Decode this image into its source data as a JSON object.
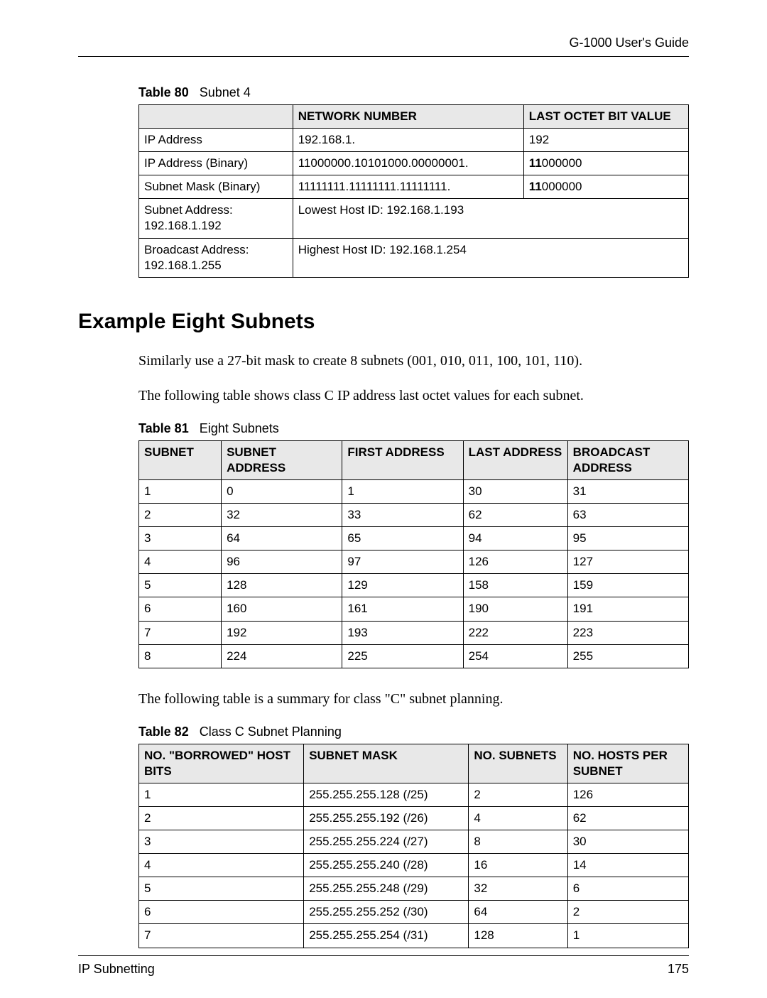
{
  "header": {
    "doc_title": "G-1000 User's Guide"
  },
  "table80": {
    "caption_label": "Table 80",
    "caption_text": "Subnet 4",
    "headers": {
      "col2": "NETWORK NUMBER",
      "col3": "LAST OCTET BIT VALUE"
    },
    "rows": {
      "r1": {
        "c1": "IP Address",
        "c2": "192.168.1.",
        "c3": "192"
      },
      "r2": {
        "c1": "IP Address (Binary)",
        "c2": "11000000.10101000.00000001.",
        "c3_bold": "11",
        "c3_rest": "000000"
      },
      "r3": {
        "c1": "Subnet Mask (Binary)",
        "c2": "11111111.11111111.11111111.",
        "c3_bold": "11",
        "c3_rest": "000000"
      },
      "r4": {
        "c1_l1": "Subnet Address:",
        "c1_l2": "192.168.1.192",
        "c2": "Lowest Host ID: 192.168.1.193"
      },
      "r5": {
        "c1_l1": "Broadcast Address:",
        "c1_l2": "192.168.1.255",
        "c2": "Highest Host ID: 192.168.1.254"
      }
    }
  },
  "section": {
    "heading": "Example Eight Subnets"
  },
  "para1": "Similarly use a 27-bit mask to create 8 subnets (001, 010, 011, 100, 101, 110).",
  "para2": "The following table shows class C IP address last octet values for each subnet.",
  "table81": {
    "caption_label": "Table 81",
    "caption_text": "Eight Subnets",
    "headers": {
      "c1": "SUBNET",
      "c2": "SUBNET ADDRESS",
      "c3": "FIRST ADDRESS",
      "c4": "LAST ADDRESS",
      "c5": "BROADCAST ADDRESS"
    },
    "rows": [
      {
        "c1": "1",
        "c2": "0",
        "c3": "1",
        "c4": "30",
        "c5": "31"
      },
      {
        "c1": "2",
        "c2": "32",
        "c3": "33",
        "c4": "62",
        "c5": "63"
      },
      {
        "c1": "3",
        "c2": "64",
        "c3": "65",
        "c4": "94",
        "c5": "95"
      },
      {
        "c1": "4",
        "c2": "96",
        "c3": "97",
        "c4": "126",
        "c5": "127"
      },
      {
        "c1": "5",
        "c2": "128",
        "c3": "129",
        "c4": "158",
        "c5": "159"
      },
      {
        "c1": "6",
        "c2": "160",
        "c3": "161",
        "c4": "190",
        "c5": "191"
      },
      {
        "c1": "7",
        "c2": "192",
        "c3": "193",
        "c4": "222",
        "c5": "223"
      },
      {
        "c1": "8",
        "c2": "224",
        "c3": "225",
        "c4": "254",
        "c5": "255"
      }
    ]
  },
  "para3": "The following table is a summary for class \"C\" subnet planning.",
  "table82": {
    "caption_label": "Table 82",
    "caption_text": "Class C Subnet Planning",
    "headers": {
      "c1": "NO. \"BORROWED\" HOST BITS",
      "c2": "SUBNET MASK",
      "c3": "NO. SUBNETS",
      "c4": "NO. HOSTS PER SUBNET"
    },
    "rows": [
      {
        "c1": "1",
        "c2": "255.255.255.128 (/25)",
        "c3": "2",
        "c4": "126"
      },
      {
        "c1": "2",
        "c2": "255.255.255.192 (/26)",
        "c3": "4",
        "c4": "62"
      },
      {
        "c1": "3",
        "c2": "255.255.255.224 (/27)",
        "c3": "8",
        "c4": "30"
      },
      {
        "c1": "4",
        "c2": "255.255.255.240 (/28)",
        "c3": "16",
        "c4": "14"
      },
      {
        "c1": "5",
        "c2": "255.255.255.248 (/29)",
        "c3": "32",
        "c4": "6"
      },
      {
        "c1": "6",
        "c2": "255.255.255.252 (/30)",
        "c3": "64",
        "c4": "2"
      },
      {
        "c1": "7",
        "c2": "255.255.255.254 (/31)",
        "c3": "128",
        "c4": "1"
      }
    ]
  },
  "footer": {
    "left": "IP Subnetting",
    "right": "175"
  }
}
